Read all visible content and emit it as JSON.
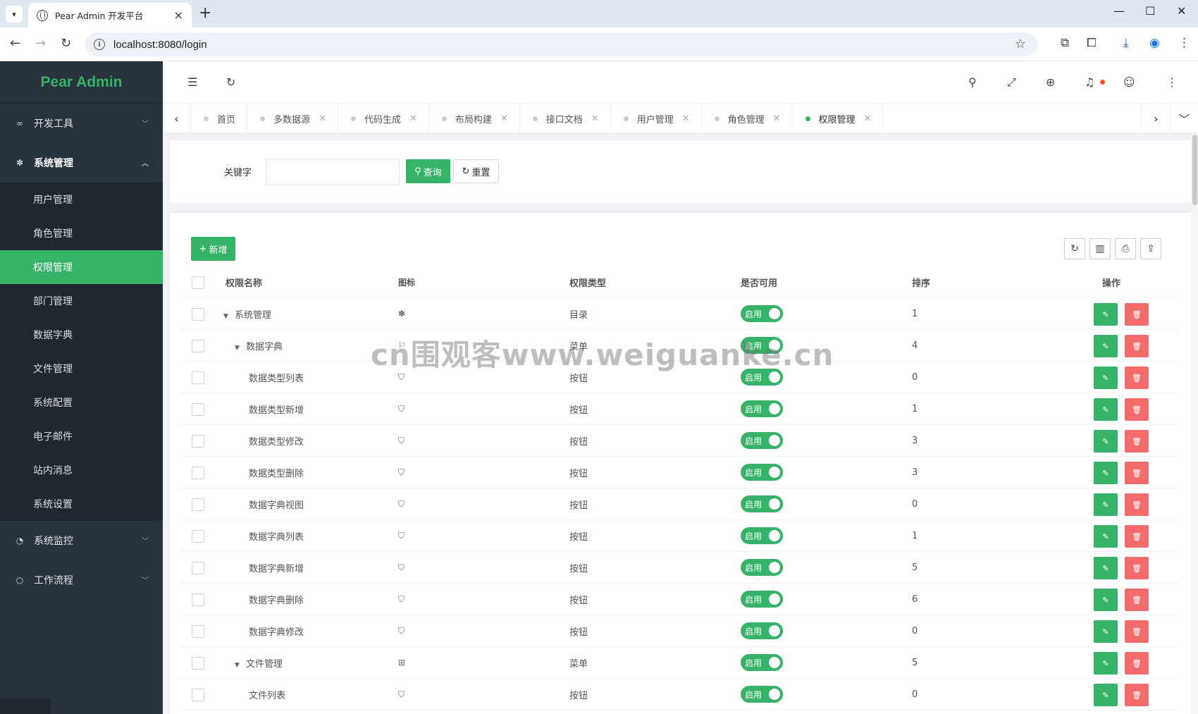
{
  "browser": {
    "tab_title": "Pear Admin 开发平台",
    "url": "localhost:8080/login"
  },
  "sidebar": {
    "logo": "Pear Admin",
    "groups": [
      {
        "label": "开发工具",
        "icon": "infinity-icon",
        "open": false
      },
      {
        "label": "系统管理",
        "icon": "gear-icon",
        "open": true
      },
      {
        "label": "系统监控",
        "icon": "gauge-icon",
        "open": false
      },
      {
        "label": "工作流程",
        "icon": "circle-icon",
        "open": false
      }
    ],
    "submenu": [
      "用户管理",
      "角色管理",
      "权限管理",
      "部门管理",
      "数据字典",
      "文件管理",
      "系统配置",
      "电子邮件",
      "站内消息",
      "系统设置"
    ],
    "active_submenu": "权限管理"
  },
  "tabs": [
    {
      "label": "首页",
      "active": false,
      "closable": false
    },
    {
      "label": "多数据源",
      "active": false,
      "closable": true
    },
    {
      "label": "代码生成",
      "active": false,
      "closable": true
    },
    {
      "label": "布局构建",
      "active": false,
      "closable": true
    },
    {
      "label": "接口文档",
      "active": false,
      "closable": true
    },
    {
      "label": "用户管理",
      "active": false,
      "closable": true
    },
    {
      "label": "角色管理",
      "active": false,
      "closable": true
    },
    {
      "label": "权限管理",
      "active": true,
      "closable": true
    }
  ],
  "search": {
    "keyword_label": "关键字",
    "keyword_value": "",
    "query_label": "查询",
    "reset_label": "重置"
  },
  "toolbar": {
    "add_label": "新增"
  },
  "table": {
    "headers": {
      "name": "权限名称",
      "icon": "图标",
      "type": "权限类型",
      "enable": "是否可用",
      "sort": "排序",
      "op": "操作"
    },
    "rows": [
      {
        "name": "系统管理",
        "level": 0,
        "expander": true,
        "icon": "gear-icon",
        "type": "目录",
        "enable": "启用",
        "sort": "1"
      },
      {
        "name": "数据字典",
        "level": 1,
        "expander": true,
        "icon": "flag-icon",
        "type": "菜单",
        "enable": "启用",
        "sort": "4"
      },
      {
        "name": "数据类型列表",
        "level": 2,
        "expander": false,
        "icon": "shield-icon",
        "type": "按钮",
        "enable": "启用",
        "sort": "0"
      },
      {
        "name": "数据类型新增",
        "level": 2,
        "expander": false,
        "icon": "shield-icon",
        "type": "按钮",
        "enable": "启用",
        "sort": "1"
      },
      {
        "name": "数据类型修改",
        "level": 2,
        "expander": false,
        "icon": "shield-icon",
        "type": "按钮",
        "enable": "启用",
        "sort": "3"
      },
      {
        "name": "数据类型删除",
        "level": 2,
        "expander": false,
        "icon": "shield-icon",
        "type": "按钮",
        "enable": "启用",
        "sort": "3"
      },
      {
        "name": "数据字典视图",
        "level": 2,
        "expander": false,
        "icon": "shield-icon",
        "type": "按钮",
        "enable": "启用",
        "sort": "0"
      },
      {
        "name": "数据字典列表",
        "level": 2,
        "expander": false,
        "icon": "shield-icon",
        "type": "按钮",
        "enable": "启用",
        "sort": "1"
      },
      {
        "name": "数据字典新增",
        "level": 2,
        "expander": false,
        "icon": "shield-icon",
        "type": "按钮",
        "enable": "启用",
        "sort": "5"
      },
      {
        "name": "数据字典删除",
        "level": 2,
        "expander": false,
        "icon": "shield-icon",
        "type": "按钮",
        "enable": "启用",
        "sort": "6"
      },
      {
        "name": "数据字典修改",
        "level": 2,
        "expander": false,
        "icon": "shield-icon",
        "type": "按钮",
        "enable": "启用",
        "sort": "0"
      },
      {
        "name": "文件管理",
        "level": 1,
        "expander": true,
        "icon": "book-icon",
        "type": "菜单",
        "enable": "启用",
        "sort": "5"
      },
      {
        "name": "文件列表",
        "level": 2,
        "expander": false,
        "icon": "shield-icon",
        "type": "按钮",
        "enable": "启用",
        "sort": "0"
      }
    ]
  },
  "watermark": "cn围观客www.weiguanke.cn",
  "colors": {
    "primary": "#36b368",
    "danger": "#f56c6c",
    "sidebar_bg": "#28333e",
    "submenu_bg": "#1f272f"
  }
}
